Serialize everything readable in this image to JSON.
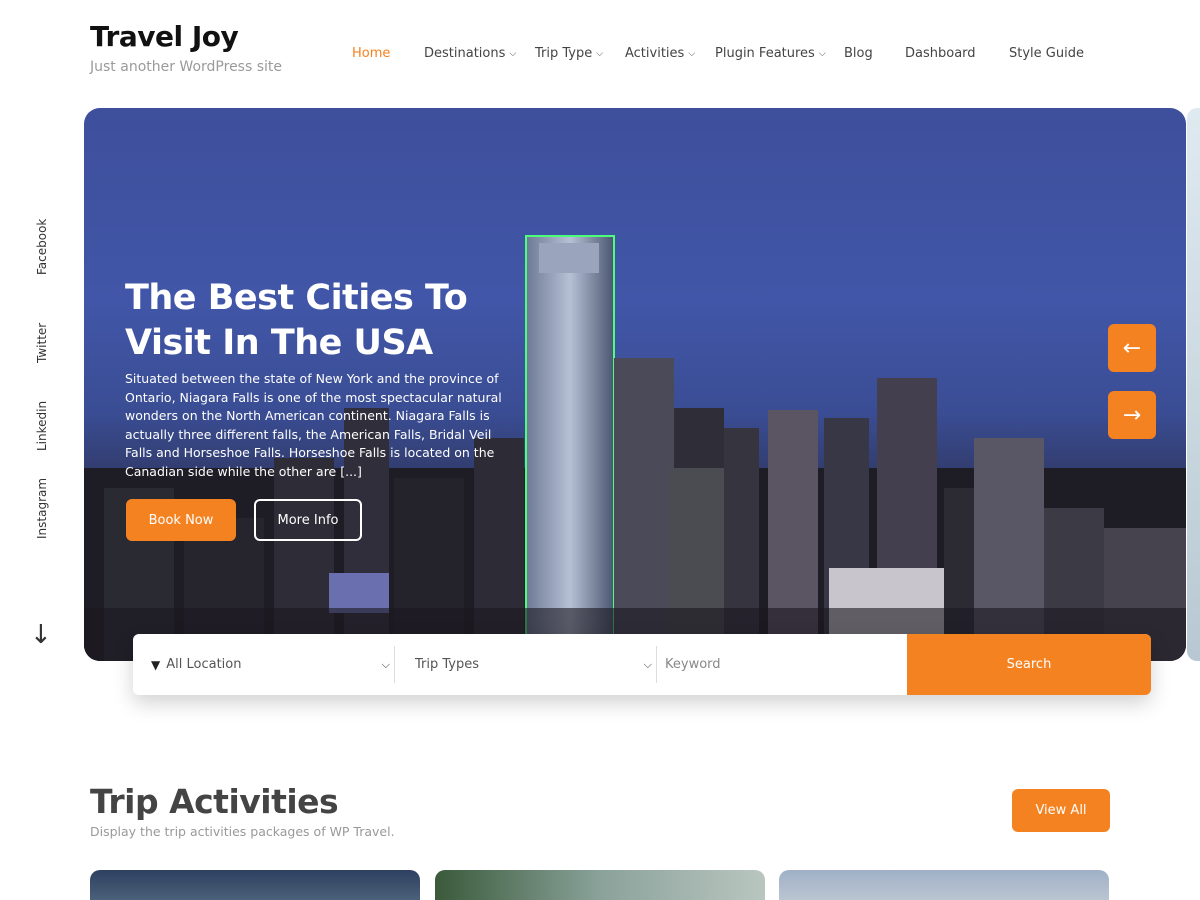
{
  "site": {
    "title": "Travel Joy",
    "tagline": "Just another WordPress site"
  },
  "nav": {
    "items": [
      {
        "label": "Home",
        "active": true,
        "dropdown": false
      },
      {
        "label": "Destinations",
        "active": false,
        "dropdown": true
      },
      {
        "label": "Trip Type",
        "active": false,
        "dropdown": true
      },
      {
        "label": "Activities",
        "active": false,
        "dropdown": true
      },
      {
        "label": "Plugin Features",
        "active": false,
        "dropdown": true
      },
      {
        "label": "Blog",
        "active": false,
        "dropdown": false
      },
      {
        "label": "Dashboard",
        "active": false,
        "dropdown": false
      },
      {
        "label": "Style Guide",
        "active": false,
        "dropdown": false
      }
    ]
  },
  "social": {
    "links": [
      "Facebook",
      "Twitter",
      "Linkedin",
      "Instagram"
    ]
  },
  "hero": {
    "heading": "The Best Cities To Visit In The USA",
    "text": "Situated between the state of New York and the province of Ontario, Niagara Falls is one of the most spectacular natural wonders on the North American continent. Niagara Falls is actually three different falls, the American Falls, Bridal Veil Falls and Horseshoe Falls. Horseshoe Falls is located on the Canadian side while the other are [...]",
    "book_label": "Book Now",
    "more_label": "More Info",
    "prev_icon": "arrow-left-icon",
    "next_icon": "arrow-right-icon"
  },
  "search": {
    "location_value": "All Location",
    "types_value": "Trip Types",
    "keyword_placeholder": "Keyword",
    "search_label": "Search"
  },
  "activities": {
    "title": "Trip Activities",
    "subtitle": "Display the trip activities packages of WP Travel.",
    "view_all_label": "View All"
  },
  "colors": {
    "accent": "#f58220",
    "hero_sky": "#4156a8"
  }
}
